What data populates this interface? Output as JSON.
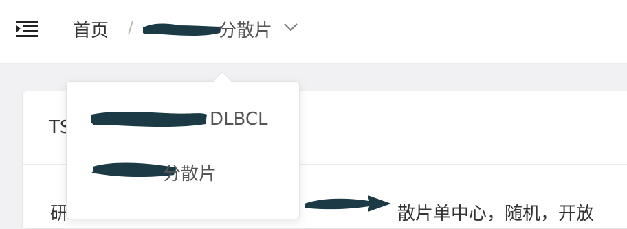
{
  "header": {
    "breadcrumb": {
      "home": "首页",
      "separator": "/",
      "current_suffix": "分散片"
    },
    "icons": {
      "menu": "menu-fold-icon",
      "dropdown": "chevron-down-icon"
    }
  },
  "dropdown": {
    "items": [
      {
        "suffix": "DLBCL"
      },
      {
        "suffix": "分散片"
      }
    ]
  },
  "card": {
    "title_prefix": "TS",
    "body_left_prefix": "研",
    "body_right": "散片单中心，随机，开放"
  },
  "colors": {
    "redaction": "#1b3a45",
    "background": "#f1f1f3"
  }
}
